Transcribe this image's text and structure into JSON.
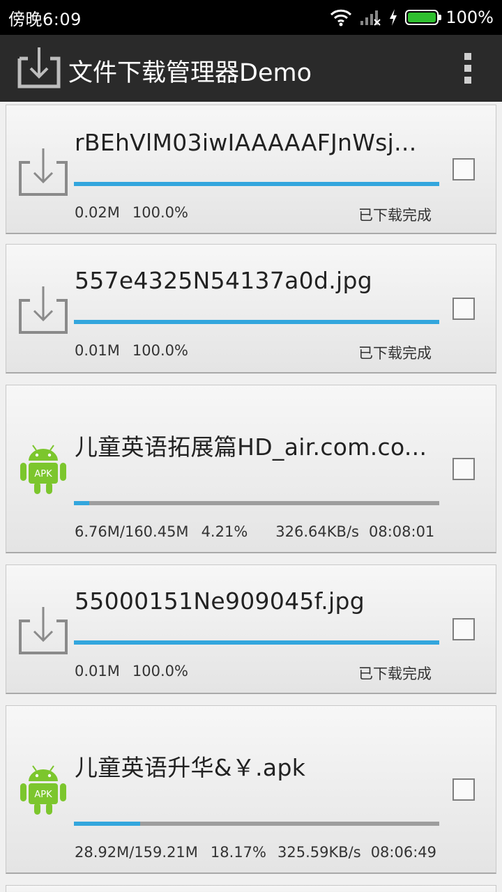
{
  "status_bar": {
    "time": "傍晚6:09",
    "battery_text": "100%",
    "battery_level": 1.0,
    "icons": [
      "wifi-icon",
      "signal-icon",
      "charging-icon",
      "battery-icon"
    ]
  },
  "action_bar": {
    "title": "文件下载管理器Demo",
    "app_icon": "download-icon",
    "menu_icon": "overflow-menu-icon"
  },
  "downloads": [
    {
      "name": "rBEhVlM03iwIAAAAAFJnWsj...",
      "icon": "download-icon",
      "size": "0.02M",
      "percent": "100.0%",
      "progress": 1.0,
      "status": "已下载完成",
      "checked": false
    },
    {
      "name": "557e4325N54137a0d.jpg",
      "icon": "download-icon",
      "size": "0.01M",
      "percent": "100.0%",
      "progress": 1.0,
      "status": "已下载完成",
      "checked": false
    },
    {
      "name": "儿童英语拓展篇HD_air.com.co...",
      "icon": "android-apk-icon",
      "size": "6.76M/160.45M",
      "percent": "4.21%",
      "speed": "326.64KB/s",
      "time_left": "08:08:01",
      "progress": 0.0421,
      "checked": false
    },
    {
      "name": "55000151Ne909045f.jpg",
      "icon": "download-icon",
      "size": "0.01M",
      "percent": "100.0%",
      "progress": 1.0,
      "status": "已下载完成",
      "checked": false
    },
    {
      "name": "儿童英语升华&￥.apk",
      "icon": "android-apk-icon",
      "size": "28.92M/159.21M",
      "percent": "18.17%",
      "speed": "325.59KB/s",
      "time_left": "08:06:49",
      "progress": 0.1817,
      "checked": false
    }
  ]
}
